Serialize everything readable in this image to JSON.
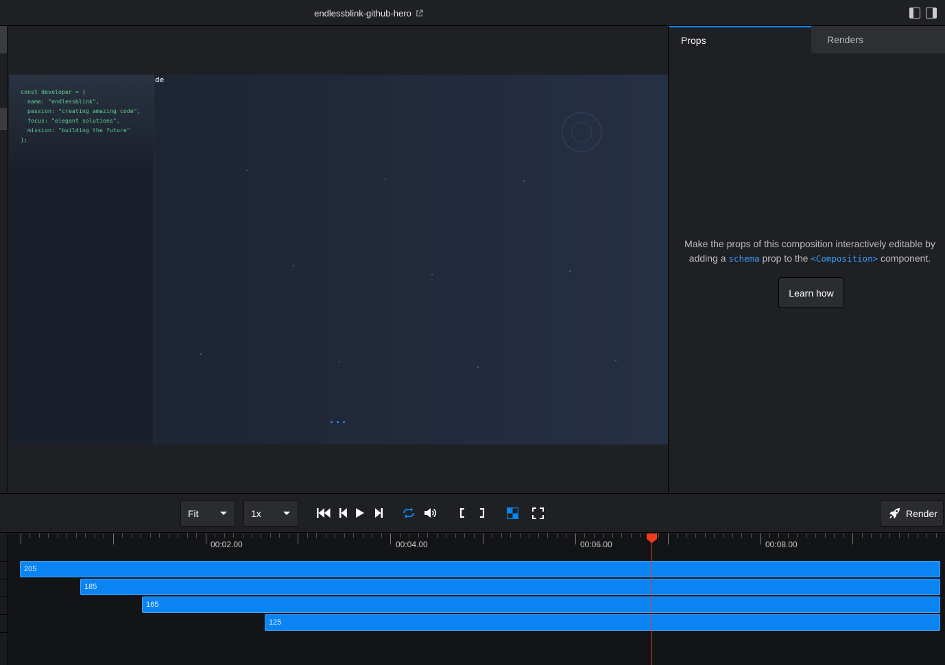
{
  "header": {
    "composition_title": "endlessblink-github-hero"
  },
  "preview": {
    "code_snippet": "const developer = {\n  name: \"endlessblink\",\n  passion: \"creating amazing code\",\n  focus: \"elegant solutions\",\n  mission: \"building the future\"\n};",
    "overlay_text": "de"
  },
  "right_panel": {
    "tabs": [
      {
        "label": "Props",
        "active": true
      },
      {
        "label": "Renders",
        "active": false
      }
    ],
    "message_part1": "Make the props of this composition interactively editable by adding a ",
    "message_code1": "schema",
    "message_part2": " prop to the ",
    "message_code2": "<Composition>",
    "message_part3": " component.",
    "learn_button": "Learn how"
  },
  "controls": {
    "zoom_select": "Fit",
    "speed_select": "1x",
    "render_button": "Render",
    "accent_color": "#0b84f3"
  },
  "timeline": {
    "time_labels": [
      "00:02.00",
      "00:04.00",
      "00:06.00",
      "00:08.00"
    ],
    "tracks": [
      {
        "label": "205"
      },
      {
        "label": "185"
      },
      {
        "label": "165"
      },
      {
        "label": "125"
      }
    ],
    "playhead_color": "#f43b1f"
  }
}
